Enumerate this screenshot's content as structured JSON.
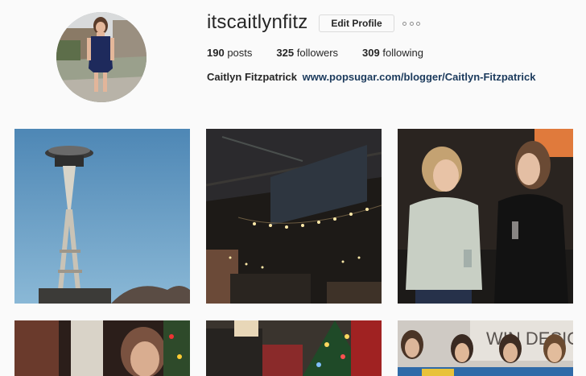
{
  "profile": {
    "username": "itscaitlynfitz",
    "edit_label": "Edit Profile",
    "posts_count": "190",
    "posts_label": "posts",
    "followers_count": "325",
    "followers_label": "followers",
    "following_count": "309",
    "following_label": "following",
    "full_name": "Caitlyn Fitzpatrick",
    "website": "www.popsugar.com/blogger/Caitlyn-Fitzpatrick"
  },
  "icons": {
    "more": "more-options-icon"
  },
  "colors": {
    "link": "#1b3a5c",
    "background": "#fafafa",
    "border": "#dbdbdb"
  }
}
